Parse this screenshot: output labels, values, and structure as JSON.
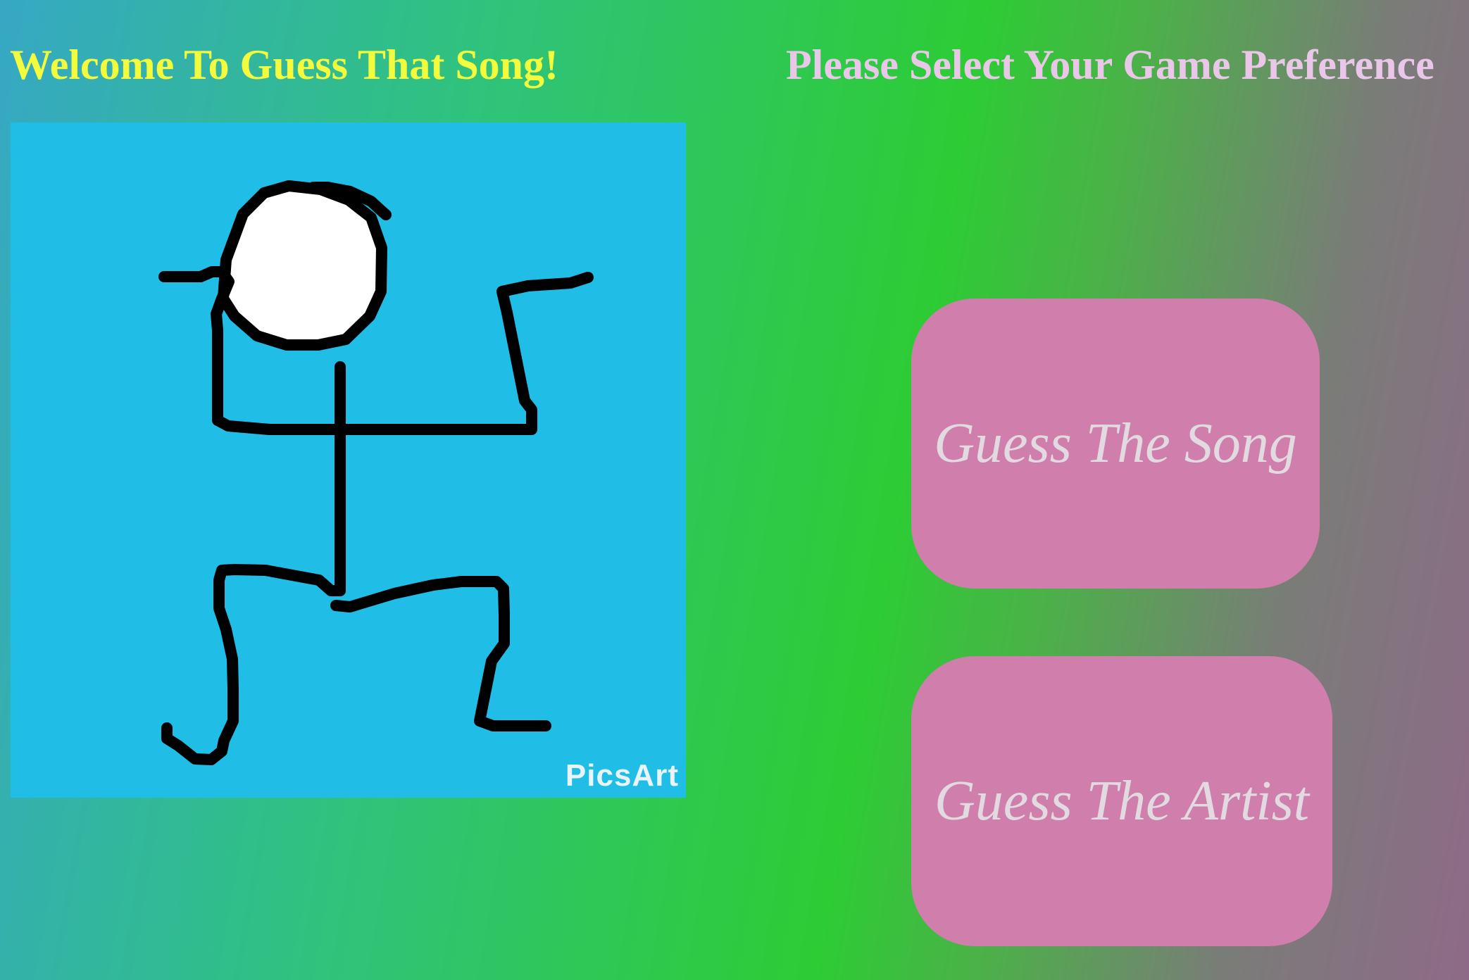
{
  "header": {
    "welcome_title": "Welcome To Guess That Song!",
    "preference_title": "Please Select Your Game Preference"
  },
  "mascot": {
    "watermark": "PicsArt",
    "background_color": "#20bde6"
  },
  "game_modes": [
    {
      "label": "Guess The Song"
    },
    {
      "label": "Guess The Artist"
    }
  ],
  "colors": {
    "welcome_title": "#f2fb3c",
    "preference_title": "#eac7e8",
    "button_fill": "#d07fac",
    "button_text": "#e1dbe1"
  }
}
